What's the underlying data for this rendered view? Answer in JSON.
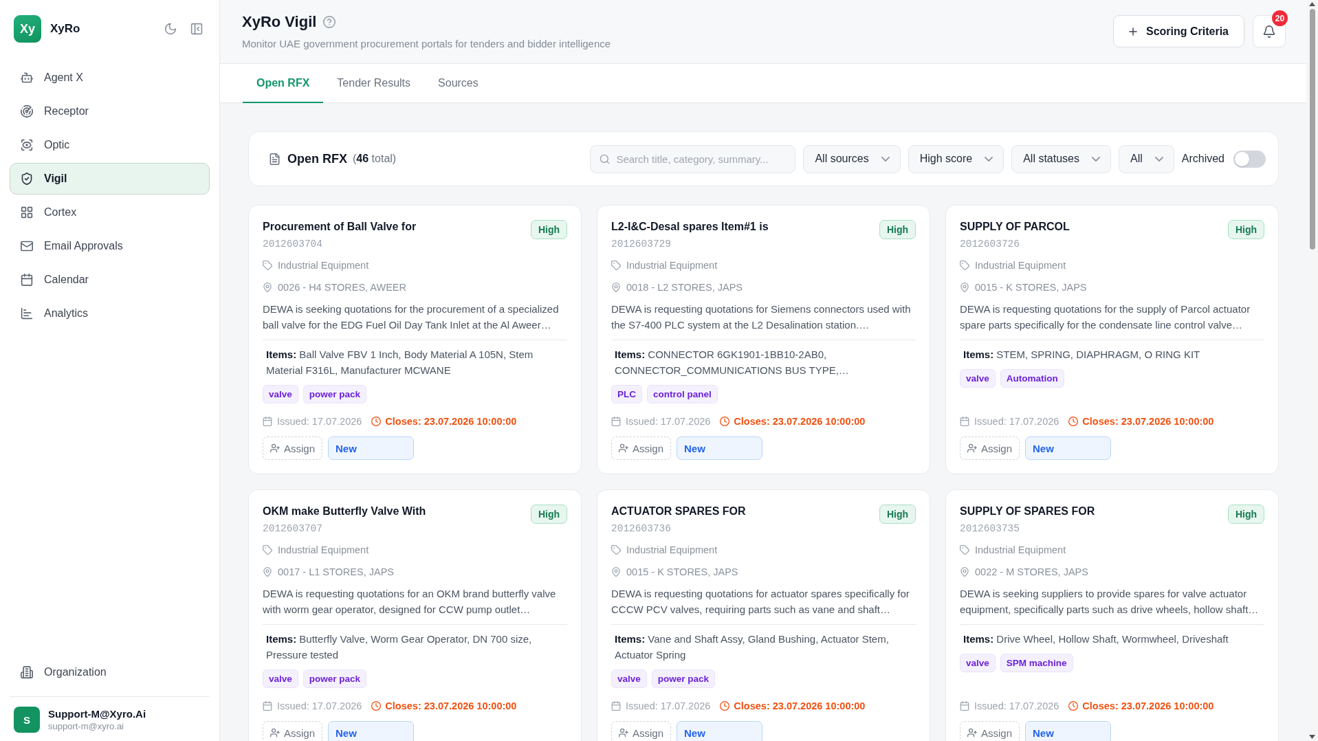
{
  "sidebar": {
    "brand": {
      "logo": "Xy",
      "name": "XyRo"
    },
    "nav": [
      {
        "label": "Agent X",
        "selected": false
      },
      {
        "label": "Receptor",
        "selected": false
      },
      {
        "label": "Optic",
        "selected": false
      },
      {
        "label": "Vigil",
        "selected": true
      },
      {
        "label": "Cortex",
        "selected": false
      },
      {
        "label": "Email Approvals",
        "selected": false
      },
      {
        "label": "Calendar",
        "selected": false
      },
      {
        "label": "Analytics",
        "selected": false
      }
    ],
    "footer_nav": [
      {
        "label": "Organization",
        "selected": false
      }
    ],
    "user": {
      "initial": "S",
      "name": "Support-M@Xyro.Ai",
      "email": "support-m@xyro.ai"
    }
  },
  "header": {
    "title": "XyRo Vigil",
    "subtitle": "Monitor UAE government procurement portals for tenders and bidder intelligence",
    "action_button": "Scoring Criteria",
    "notifications": {
      "count": "20"
    }
  },
  "tabs": [
    {
      "label": "Open RFX",
      "selected": true
    },
    {
      "label": "Tender Results",
      "selected": false
    },
    {
      "label": "Sources",
      "selected": false
    }
  ],
  "list_toolbar": {
    "title": "Open RFX",
    "total": "(**46** total)",
    "search": {
      "placeholder": "Search title, category, summary..."
    },
    "filters": [
      {
        "value": "All sources"
      },
      {
        "value": "High score"
      },
      {
        "value": "All statuses"
      },
      {
        "value": "All"
      }
    ],
    "archived": {
      "label": "Archived",
      "on": false
    }
  },
  "cards": [
    {
      "title": "Procurement of Ball Valve for",
      "id": "2012603704",
      "priority": "High",
      "category": "Industrial Equipment",
      "location": "0026 - H4 STORES, AWEER",
      "summary": "DEWA is seeking quotations for the procurement of a specialized ball valve for the EDG Fuel Oil Day Tank Inlet at the Al Aweer…",
      "items": "**Items:** Ball Valve FBV 1 Inch, Body Material A 105N, Stem Material F316L, Manufacturer MCWANE",
      "tags": [
        "valve",
        "power pack"
      ],
      "issued": "Issued: 17.07.2026",
      "closes": "Closes: 23.07.2026 10:00:00",
      "assign": "Assign",
      "status": "New"
    },
    {
      "title": "L2-I&C-Desal spares Item#1 is",
      "id": "2012603729",
      "priority": "High",
      "category": "Industrial Equipment",
      "location": "0018 - L2 STORES, JAPS",
      "summary": "DEWA is requesting quotations for Siemens connectors used with the S7-400 PLC system at the L2 Desalination station.…",
      "items": "**Items:** CONNECTOR 6GK1901-1BB10-2AB0, CONNECTOR_COMMUNICATIONS BUS TYPE,…",
      "tags": [
        "PLC",
        "control panel"
      ],
      "issued": "Issued: 17.07.2026",
      "closes": "Closes: 23.07.2026 10:00:00",
      "assign": "Assign",
      "status": "New"
    },
    {
      "title": "SUPPLY OF PARCOL",
      "id": "2012603726",
      "priority": "High",
      "category": "Industrial Equipment",
      "location": "0015 - K STORES, JAPS",
      "summary": "DEWA is requesting quotations for the supply of Parcol actuator spare parts specifically for the condensate line control valve…",
      "items": "**Items:** STEM, SPRING, DIAPHRAGM, O RING KIT",
      "tags": [
        "valve",
        "Automation"
      ],
      "issued": "Issued: 17.07.2026",
      "closes": "Closes: 23.07.2026 10:00:00",
      "assign": "Assign",
      "status": "New"
    },
    {
      "title": "OKM make Butterfly Valve With",
      "id": "2012603707",
      "priority": "High",
      "category": "Industrial Equipment",
      "location": "0017 - L1 STORES, JAPS",
      "summary": "DEWA is requesting quotations for an OKM brand butterfly valve with worm gear operator, designed for CCW pump outlet…",
      "items": "**Items:** Butterfly Valve, Worm Gear Operator, DN 700 size, Pressure tested",
      "tags": [
        "valve",
        "power pack"
      ],
      "issued": "Issued: 17.07.2026",
      "closes": "Closes: 23.07.2026 10:00:00",
      "assign": "Assign",
      "status": "New"
    },
    {
      "title": "ACTUATOR SPARES FOR",
      "id": "2012603736",
      "priority": "High",
      "category": "Industrial Equipment",
      "location": "0015 - K STORES, JAPS",
      "summary": "DEWA is requesting quotations for actuator spares specifically for CCCW PCV valves, requiring parts such as vane and shaft…",
      "items": "**Items:** Vane and Shaft Assy, Gland Bushing, Actuator Stem, Actuator Spring",
      "tags": [
        "valve",
        "power pack"
      ],
      "issued": "Issued: 17.07.2026",
      "closes": "Closes: 23.07.2026 10:00:00",
      "assign": "Assign",
      "status": "New"
    },
    {
      "title": "SUPPLY OF SPARES FOR",
      "id": "2012603735",
      "priority": "High",
      "category": "Industrial Equipment",
      "location": "0022 - M STORES, JAPS",
      "summary": "DEWA is seeking suppliers to provide spares for valve actuator equipment, specifically parts such as drive wheels, hollow shaft…",
      "items": "**Items:** Drive Wheel, Hollow Shaft, Wormwheel, Driveshaft",
      "tags": [
        "valve",
        "SPM machine"
      ],
      "issued": "Issued: 17.07.2026",
      "closes": "Closes: 23.07.2026 10:00:00",
      "assign": "Assign",
      "status": "New"
    }
  ]
}
